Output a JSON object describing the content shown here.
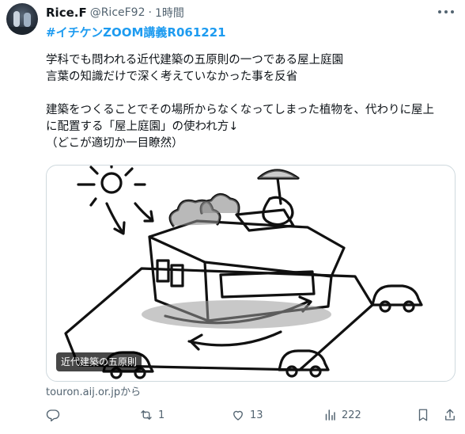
{
  "tweet": {
    "author_name": "Rice.F",
    "author_handle": "@RiceF92",
    "separator": "·",
    "time": "1時間",
    "hashtag": "#イチケンZOOM講義R061221",
    "body_lines": [
      "学科でも問われる近代建築の五原則の一つである屋上庭園",
      "言葉の知識だけで深く考えていなかった事を反省",
      "",
      "建築をつくることでその場所からなくなってしまった植物を、代わりに屋上",
      "に配置する「屋上庭園」の使われ方↓",
      "（どこが適切か一目瞭然）"
    ],
    "media_caption": "近代建築の五原則",
    "source_text": "touron.aij.or.jpから"
  },
  "actions": {
    "reply_count": "",
    "retweet_count": "1",
    "like_count": "13",
    "views_count": "222"
  },
  "icons": {
    "more": "more-dots-icon",
    "reply": "reply-icon",
    "retweet": "retweet-icon",
    "like": "heart-icon",
    "views": "views-icon",
    "bookmark": "bookmark-icon",
    "share": "share-icon"
  },
  "colors": {
    "link": "#1d9bf0",
    "text": "#0f1419",
    "muted": "#536471",
    "border": "#cfd9de"
  }
}
